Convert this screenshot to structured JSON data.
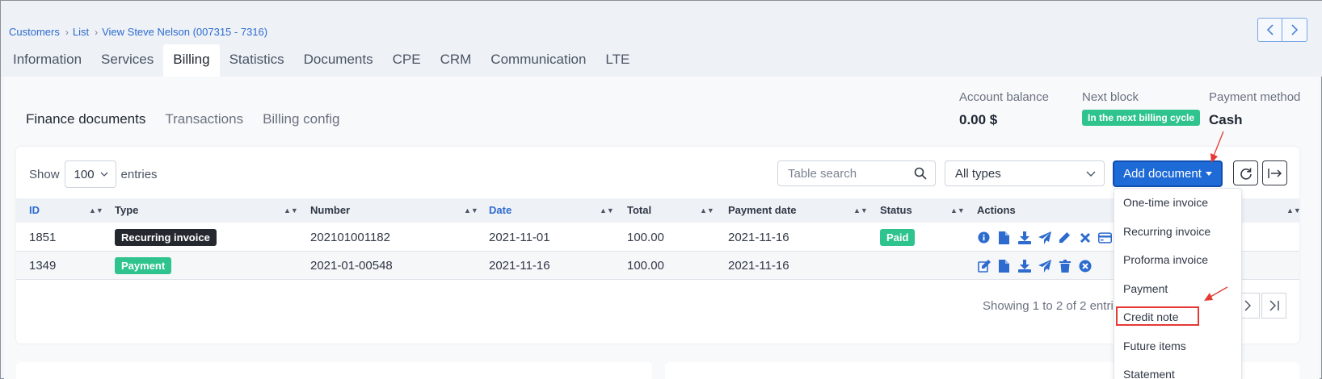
{
  "breadcrumb": {
    "root": "Customers",
    "list": "List",
    "current": "View Steve Nelson (007315 - 7316)"
  },
  "main_tabs": [
    {
      "label": "Information"
    },
    {
      "label": "Services"
    },
    {
      "label": "Billing"
    },
    {
      "label": "Statistics"
    },
    {
      "label": "Documents"
    },
    {
      "label": "CPE"
    },
    {
      "label": "CRM"
    },
    {
      "label": "Communication"
    },
    {
      "label": "LTE"
    }
  ],
  "sub_tabs": [
    {
      "label": "Finance documents"
    },
    {
      "label": "Transactions"
    },
    {
      "label": "Billing config"
    }
  ],
  "summary": {
    "balance_label": "Account balance",
    "balance_value": "0.00 $",
    "next_block_label": "Next block",
    "next_block_value": "In the next billing cycle",
    "payment_method_label": "Payment method",
    "payment_method_value": "Cash"
  },
  "table_controls": {
    "show_label": "Show",
    "entries_value": "100",
    "entries_label": "entries",
    "search_placeholder": "Table search",
    "type_filter": "All types",
    "add_document": "Add document"
  },
  "columns": [
    "ID",
    "Type",
    "Number",
    "Date",
    "Total",
    "Payment date",
    "Status",
    "Actions"
  ],
  "rows": [
    {
      "id": "1851",
      "type": "Recurring invoice",
      "number": "202101001182",
      "date": "2021-11-01",
      "total": "100.00",
      "payment_date": "2021-11-16",
      "status": "Paid"
    },
    {
      "id": "1349",
      "type": "Payment",
      "number": "2021-01-00548",
      "date": "2021-11-16",
      "total": "100.00",
      "payment_date": "2021-11-16",
      "status": ""
    }
  ],
  "footer": {
    "showing": "Showing 1 to 2 of 2 entri"
  },
  "dropdown": [
    {
      "label": "One-time invoice"
    },
    {
      "label": "Recurring invoice"
    },
    {
      "label": "Proforma invoice"
    },
    {
      "label": "Payment"
    },
    {
      "label": "Credit note"
    },
    {
      "label": "Future items"
    },
    {
      "label": "Statement"
    }
  ],
  "colors": {
    "accent": "#1e6ad6",
    "link": "#2d6bcf",
    "success": "#2fc48d",
    "annotation": "#e53935"
  }
}
